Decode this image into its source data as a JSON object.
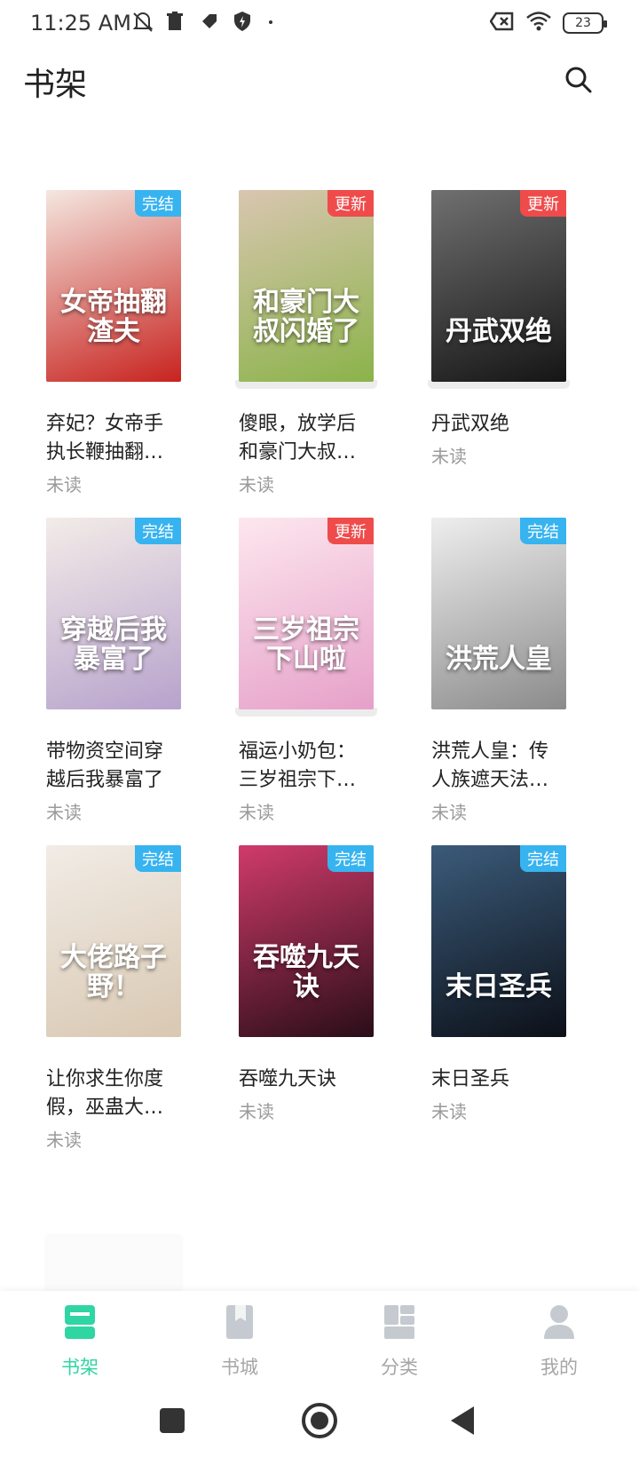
{
  "status_bar": {
    "time": "11:25 AM",
    "battery": "23",
    "left_icons": [
      "mute-icon",
      "trash-icon",
      "tag-icon",
      "shield-icon",
      "dot-icon"
    ],
    "right_icons": [
      "x-box-icon",
      "wifi-icon",
      "battery-icon"
    ]
  },
  "header": {
    "title": "书架",
    "search_icon": "search-icon"
  },
  "books": [
    {
      "title": "弃妃？女帝手执长鞭抽翻渣...",
      "status": "未读",
      "badge": "完结",
      "badge_type": "done",
      "cover_text": "女帝抽翻渣夫",
      "cover_colors": [
        "#f4e7e0",
        "#c8231f"
      ]
    },
    {
      "title": "傻眼，放学后和豪门大叔闪...",
      "status": "未读",
      "badge": "更新",
      "badge_type": "update",
      "cover_text": "和豪门大叔闪婚了",
      "cover_colors": [
        "#d9c6b0",
        "#8bb34a"
      ]
    },
    {
      "title": "丹武双绝",
      "status": "未读",
      "badge": "更新",
      "badge_type": "update",
      "cover_text": "丹武双绝",
      "cover_colors": [
        "#707070",
        "#151515"
      ]
    },
    {
      "title": "带物资空间穿越后我暴富了",
      "status": "未读",
      "badge": "完结",
      "badge_type": "done",
      "cover_text": "穿越后我暴富了",
      "cover_colors": [
        "#f3ece8",
        "#b7a2cc"
      ]
    },
    {
      "title": "福运小奶包：三岁祖宗下山...",
      "status": "未读",
      "badge": "更新",
      "badge_type": "update",
      "cover_text": "三岁祖宗下山啦",
      "cover_colors": [
        "#fde7ee",
        "#e6a0c9"
      ]
    },
    {
      "title": "洪荒人皇：传人族遮天法杀...",
      "status": "未读",
      "badge": "完结",
      "badge_type": "done",
      "cover_text": "洪荒人皇",
      "cover_colors": [
        "#eeeeee",
        "#8b8b8b"
      ]
    },
    {
      "title": "让你求生你度假，巫蛊大佬...",
      "status": "未读",
      "badge": "完结",
      "badge_type": "done",
      "cover_text": "大佬路子野！",
      "cover_colors": [
        "#f1ece6",
        "#d9c8b2"
      ]
    },
    {
      "title": "吞噬九天诀",
      "status": "未读",
      "badge": "完结",
      "badge_type": "done",
      "cover_text": "吞噬九天诀",
      "cover_colors": [
        "#d03b6b",
        "#2a0d18"
      ]
    },
    {
      "title": "末日圣兵",
      "status": "未读",
      "badge": "完结",
      "badge_type": "done",
      "cover_text": "末日圣兵",
      "cover_colors": [
        "#3b5b7a",
        "#0c1018"
      ]
    }
  ],
  "tabs": [
    {
      "label": "书架",
      "icon": "bookshelf-icon",
      "active": true
    },
    {
      "label": "书城",
      "icon": "bookstore-icon",
      "active": false
    },
    {
      "label": "分类",
      "icon": "category-icon",
      "active": false
    },
    {
      "label": "我的",
      "icon": "profile-icon",
      "active": false
    }
  ],
  "colors": {
    "accent": "#2fd5a2",
    "badge_done": "#37b3f0",
    "badge_update": "#ef4b4b",
    "muted": "#9a9a9a"
  }
}
